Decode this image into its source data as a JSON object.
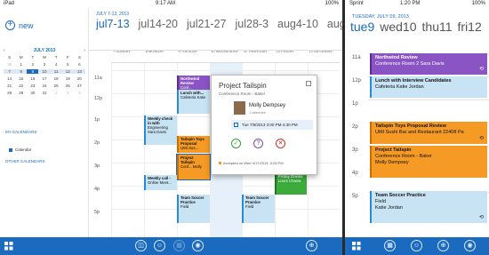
{
  "tablet": {
    "status": {
      "left": "iPad",
      "time": "9:17 AM",
      "battery": "100%"
    },
    "sidebar": {
      "new_label": "new",
      "mini_month": "JULY 2013",
      "mini_prev": "‹",
      "mini_next": "›",
      "weekdays": [
        "S",
        "M",
        "T",
        "W",
        "T",
        "F",
        "S"
      ],
      "days": [
        "30",
        "1",
        "2",
        "3",
        "4",
        "5",
        "6",
        "7",
        "8",
        "9",
        "10",
        "11",
        "12",
        "13",
        "14",
        "15",
        "16",
        "17",
        "18",
        "19",
        "20",
        "21",
        "22",
        "23",
        "24",
        "25",
        "26",
        "27",
        "28",
        "29",
        "30",
        "31",
        "1",
        "2",
        "3"
      ],
      "my_calendars": "MY CALENDARS",
      "calendar_item": "Calendar",
      "other_calendars": "OTHER CALENDARS"
    },
    "week": {
      "small_range": "JULY 7-13, 2013",
      "ranges": [
        "jul7-13",
        "jul14-20",
        "jul21-27",
        "jul28-3",
        "aug4-10",
        "aug11-17"
      ],
      "day_names": [
        "7 SUNDAY",
        "8 MONDAY",
        "9 TUESDAY",
        "10 WEDNESDAY",
        "11 THURSDAY",
        "12 FRIDAY",
        "13 SATURDAY"
      ],
      "hours": [
        "11a",
        "12p",
        "1p",
        "2p",
        "3p",
        "4p",
        "5p"
      ]
    },
    "events": [
      {
        "title": "Northwind Review",
        "sub": "Conf...",
        "color": "purple"
      },
      {
        "title": "Lunch with...",
        "sub": "Cafeteria Katie",
        "color": "blue"
      },
      {
        "title": "Weekly check in with",
        "sub": "Engineering Sara Davis",
        "color": "blue"
      },
      {
        "title": "Tailspin Toys Proposal",
        "sub": "UMI Sus...",
        "color": "orange"
      },
      {
        "title": "Project Tailspin",
        "sub": "Conf... Molly",
        "color": "orange"
      },
      {
        "title": "Weekly call -",
        "sub": "Online Meet...",
        "color": "blue"
      },
      {
        "title": "Team Soccer Practice",
        "sub": "Field",
        "color": "blue"
      },
      {
        "title": "Team Soccer Practice",
        "sub": "Field",
        "color": "blue"
      },
      {
        "title": "Friday Drinks",
        "sub": "Lisa's Chavia",
        "color": "green"
      }
    ],
    "popup": {
      "title": "Project Tailspin",
      "location": "Conference Room - Baker",
      "person": "Molly Dempsey",
      "role": "1 attendee",
      "when": "Tue 7/9/2013 3:00 PM-4:30 PM",
      "accepted": "Accepted on Wed 4/17/2013, 5:25 PM"
    },
    "appbar": [
      "◫",
      "☺",
      "▦",
      "◉",
      "⊕"
    ]
  },
  "phone": {
    "status": {
      "left": "Sprint",
      "time": "1:20 PM",
      "battery": "100%"
    },
    "date_label": "TUESDAY, JULY 09, 2013",
    "days": [
      "tue9",
      "wed10",
      "thu11",
      "fri12"
    ],
    "hours": [
      "11a",
      "12p",
      "1p",
      "2p",
      "3p",
      "4p",
      "5p"
    ],
    "events": [
      {
        "title": "Northwind Review",
        "sub": "Conference Room 2 Sara Davis",
        "color": "purple"
      },
      {
        "title": "Lunch with Interview Candidates",
        "sub": "Cafeteria Katie Jordan",
        "color": "blue"
      },
      {
        "title": "Tailspin Toys Proposal Review",
        "sub": "UMI Sushi Bar and Restaurant 22408 Pa",
        "color": "orange"
      },
      {
        "title": "Project Tailspin",
        "sub": "Conference Room - Baker",
        "sub2": "Molly Dempsey",
        "color": "orange"
      },
      {
        "title": "Team Soccer Practice",
        "sub": "Field",
        "sub2": "Katie Jordan",
        "color": "blue"
      }
    ],
    "repeat_icon": "⟲",
    "appbar": [
      "▦",
      "☺",
      "⊕",
      "◉"
    ]
  },
  "colors": {
    "accent": "#1a6bbf",
    "orange": "#f59a24",
    "purple": "#8a54c4",
    "blue_event": "#c8e3f4",
    "green": "#3dab3b"
  }
}
